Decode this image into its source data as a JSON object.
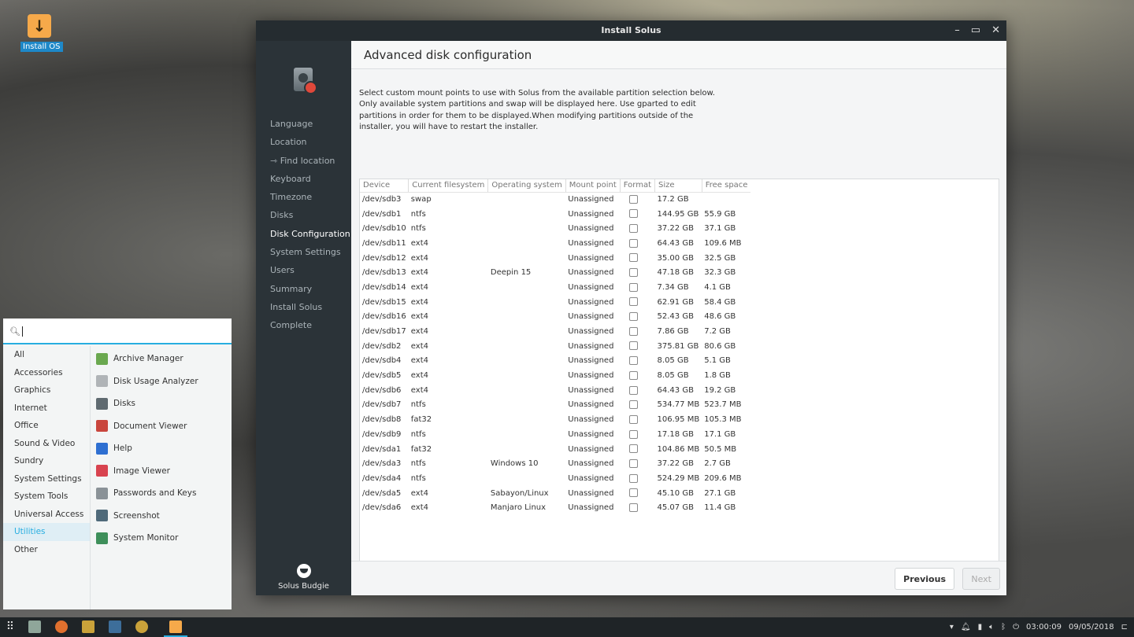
{
  "desktop": {
    "install_icon_label": "Install OS"
  },
  "window": {
    "title": "Install Solus",
    "controls": {
      "minimize": "–",
      "maximize": "▭",
      "close": "✕"
    }
  },
  "sidebar": {
    "items": [
      {
        "label": "Language"
      },
      {
        "label": "Location"
      },
      {
        "label": "⇾ Find location"
      },
      {
        "label": "Keyboard"
      },
      {
        "label": "Timezone"
      },
      {
        "label": "Disks"
      },
      {
        "label": "Disk Configuration",
        "active": true
      },
      {
        "label": "System Settings"
      },
      {
        "label": "Users"
      },
      {
        "label": "Summary"
      },
      {
        "label": "Install Solus"
      },
      {
        "label": "Complete"
      }
    ],
    "brand": "Solus Budgie"
  },
  "page": {
    "title": "Advanced disk configuration",
    "description": "Select custom mount points to use with Solus from the available partition selection below. Only available system partitions and swap will be displayed here. Use gparted to edit partitions in order for them to be displayed.When modifying partitions outside of the installer, you will have to restart the installer."
  },
  "table": {
    "columns": [
      "Device",
      "Current filesystem",
      "Operating system",
      "Mount point",
      "Format",
      "Size",
      "Free space"
    ],
    "rows": [
      [
        "/dev/sdb3",
        "swap",
        "",
        "Unassigned",
        "17.2 GB",
        ""
      ],
      [
        "/dev/sdb1",
        "ntfs",
        "",
        "Unassigned",
        "144.95 GB",
        "55.9 GB"
      ],
      [
        "/dev/sdb10",
        "ntfs",
        "",
        "Unassigned",
        "37.22 GB",
        "37.1 GB"
      ],
      [
        "/dev/sdb11",
        "ext4",
        "",
        "Unassigned",
        "64.43 GB",
        "109.6 MB"
      ],
      [
        "/dev/sdb12",
        "ext4",
        "",
        "Unassigned",
        "35.00 GB",
        "32.5 GB"
      ],
      [
        "/dev/sdb13",
        "ext4",
        "Deepin 15",
        "Unassigned",
        "47.18 GB",
        "32.3 GB"
      ],
      [
        "/dev/sdb14",
        "ext4",
        "",
        "Unassigned",
        "7.34 GB",
        "4.1 GB"
      ],
      [
        "/dev/sdb15",
        "ext4",
        "",
        "Unassigned",
        "62.91 GB",
        "58.4 GB"
      ],
      [
        "/dev/sdb16",
        "ext4",
        "",
        "Unassigned",
        "52.43 GB",
        "48.6 GB"
      ],
      [
        "/dev/sdb17",
        "ext4",
        "",
        "Unassigned",
        "7.86 GB",
        "7.2 GB"
      ],
      [
        "/dev/sdb2",
        "ext4",
        "",
        "Unassigned",
        "375.81 GB",
        "80.6 GB"
      ],
      [
        "/dev/sdb4",
        "ext4",
        "",
        "Unassigned",
        "8.05 GB",
        "5.1 GB"
      ],
      [
        "/dev/sdb5",
        "ext4",
        "",
        "Unassigned",
        "8.05 GB",
        "1.8 GB"
      ],
      [
        "/dev/sdb6",
        "ext4",
        "",
        "Unassigned",
        "64.43 GB",
        "19.2 GB"
      ],
      [
        "/dev/sdb7",
        "ntfs",
        "",
        "Unassigned",
        "534.77 MB",
        "523.7 MB"
      ],
      [
        "/dev/sdb8",
        "fat32",
        "",
        "Unassigned",
        "106.95 MB",
        "105.3 MB"
      ],
      [
        "/dev/sdb9",
        "ntfs",
        "",
        "Unassigned",
        "17.18 GB",
        "17.1 GB"
      ],
      [
        "/dev/sda1",
        "fat32",
        "",
        "Unassigned",
        "104.86 MB",
        "50.5 MB"
      ],
      [
        "/dev/sda3",
        "ntfs",
        "Windows 10",
        "Unassigned",
        "37.22 GB",
        "2.7 GB"
      ],
      [
        "/dev/sda4",
        "ntfs",
        "",
        "Unassigned",
        "524.29 MB",
        "209.6 MB"
      ],
      [
        "/dev/sda5",
        "ext4",
        "Sabayon/Linux",
        "Unassigned",
        "45.10 GB",
        "27.1 GB"
      ],
      [
        "/dev/sda6",
        "ext4",
        "Manjaro Linux",
        "Unassigned",
        "45.07 GB",
        "11.4 GB"
      ]
    ]
  },
  "buttons": {
    "previous": "Previous",
    "next": "Next"
  },
  "menu": {
    "search_value": "",
    "categories": [
      {
        "label": "All"
      },
      {
        "label": "Accessories"
      },
      {
        "label": "Graphics"
      },
      {
        "label": "Internet"
      },
      {
        "label": "Office"
      },
      {
        "label": "Sound & Video"
      },
      {
        "label": "Sundry"
      },
      {
        "label": "System Settings"
      },
      {
        "label": "System Tools"
      },
      {
        "label": "Universal Access"
      },
      {
        "label": "Utilities",
        "active": true
      },
      {
        "label": "Other"
      }
    ],
    "apps": [
      {
        "label": "Archive Manager",
        "icon": "archive-manager-icon",
        "color": "#6aa84f"
      },
      {
        "label": "Disk Usage Analyzer",
        "icon": "disk-usage-analyzer-icon",
        "color": "#b0b4b7"
      },
      {
        "label": "Disks",
        "icon": "disks-icon",
        "color": "#5f6a70"
      },
      {
        "label": "Document Viewer",
        "icon": "document-viewer-icon",
        "color": "#c9463d"
      },
      {
        "label": "Help",
        "icon": "help-icon",
        "color": "#2e6fd1"
      },
      {
        "label": "Image Viewer",
        "icon": "image-viewer-icon",
        "color": "#d8434f"
      },
      {
        "label": "Passwords and Keys",
        "icon": "passwords-and-keys-icon",
        "color": "#8a9297"
      },
      {
        "label": "Screenshot",
        "icon": "screenshot-icon",
        "color": "#4f6a7a"
      },
      {
        "label": "System Monitor",
        "icon": "system-monitor-icon",
        "color": "#3e8f5a"
      }
    ]
  },
  "taskbar": {
    "clock": "03:00:09",
    "date": "09/05/2018",
    "accent": "#28aee0"
  }
}
